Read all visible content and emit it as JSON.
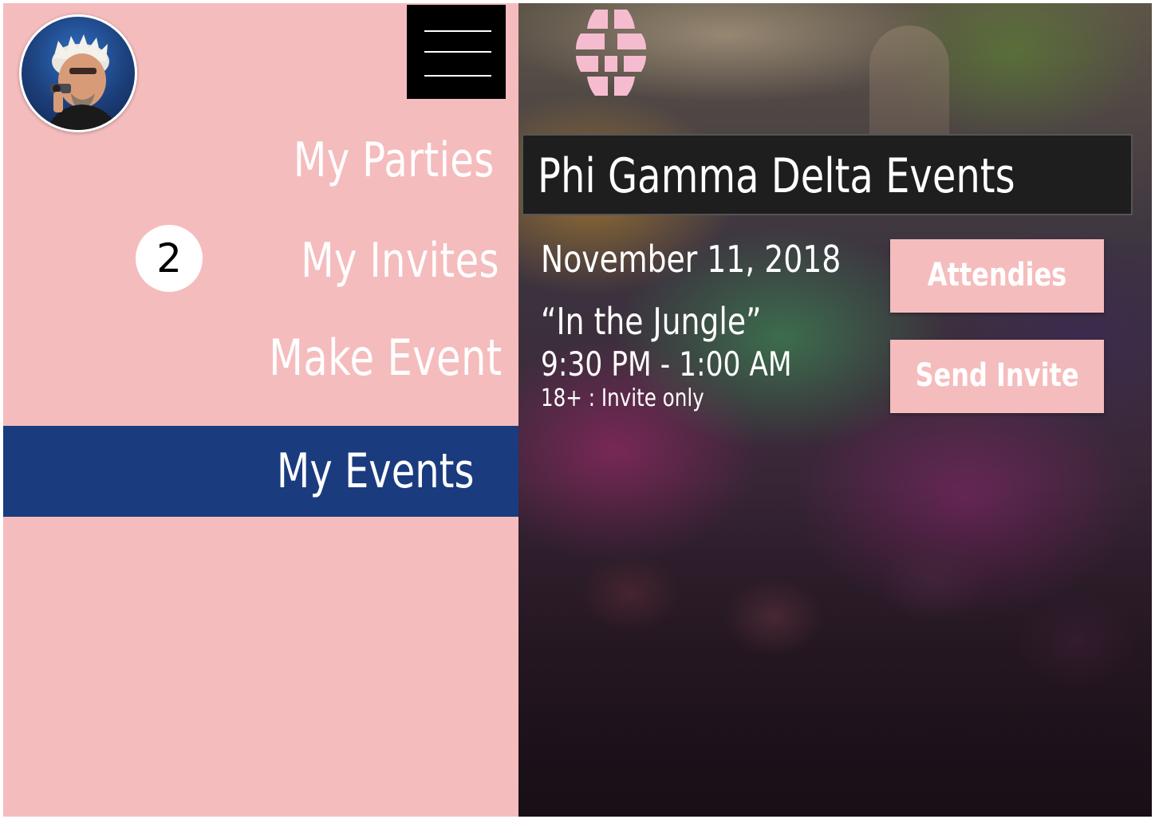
{
  "sidebar": {
    "nav": {
      "parties": "My Parties",
      "invites": "My Invites",
      "invites_badge": "2",
      "make_event": "Make Event",
      "events": "My Events"
    }
  },
  "main": {
    "title": "Phi Gamma Delta Events",
    "event": {
      "date": "November 11, 2018",
      "theme": "“In the Jungle”",
      "time": "9:30 PM - 1:00 AM",
      "restriction": "18+ : Invite only"
    },
    "buttons": {
      "attendees": "Attendies",
      "send_invite": "Send Invite"
    }
  },
  "colors": {
    "sidebar_bg": "#f5bcbd",
    "active_nav_bg": "#1b3b7f",
    "title_bar_bg": "#1e1e1e",
    "button_bg": "#f5bcbd",
    "logo": "#f5bcd0"
  },
  "icons": {
    "menu": "hamburger-menu-icon",
    "logo": "globe-logo-icon"
  }
}
